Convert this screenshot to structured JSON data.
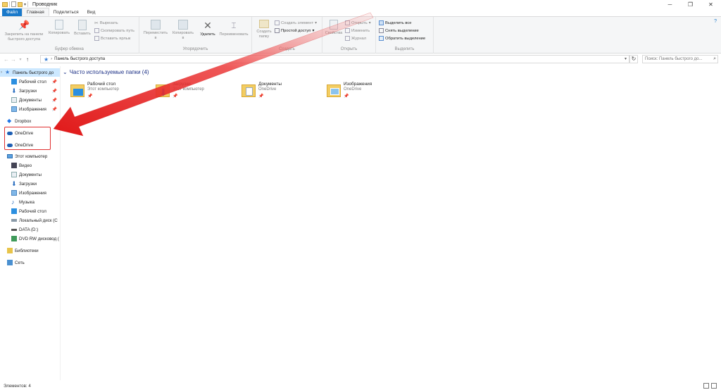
{
  "window": {
    "title": "Проводник",
    "controls": [
      "minimize",
      "maximize",
      "close"
    ]
  },
  "tabs": [
    {
      "label": "Файл",
      "kind": "file"
    },
    {
      "label": "Главная",
      "active": true
    },
    {
      "label": "Поделиться"
    },
    {
      "label": "Вид"
    }
  ],
  "ribbon": {
    "clipboard": {
      "pin_label": "Закрепить на панели\nбыстрого доступа",
      "copy_label": "Копировать",
      "paste_label": "Вставить",
      "cut_label": "Вырезать",
      "copy_path_label": "Скопировать путь",
      "paste_shortcut_label": "Вставить ярлык",
      "group_label": "Буфер обмена"
    },
    "organize": {
      "move_label": "Переместить\nв",
      "copy_to_label": "Копировать\nв",
      "delete_label": "Удалить",
      "rename_label": "Переименовать",
      "group_label": "Упорядочить"
    },
    "new": {
      "new_folder_label": "Создать\nпапку",
      "new_item_label": "Создать элемент",
      "easy_access_label": "Простой доступ",
      "group_label": "Создать"
    },
    "open": {
      "properties_label": "Свойства",
      "open_label": "Открыть",
      "edit_label": "Изменить",
      "history_label": "Журнал",
      "group_label": "Открыть"
    },
    "select": {
      "select_all_label": "Выделить все",
      "select_none_label": "Снять выделение",
      "invert_label": "Обратить выделение",
      "group_label": "Выделить"
    }
  },
  "address": {
    "path": "Панель быстрого доступа",
    "search_placeholder": "Поиск: Панель быстрого до..."
  },
  "nav": {
    "quick_access": "Панель быстрого до",
    "pinned": [
      "Рабочий стол",
      "Загрузки",
      "Документы",
      "Изображения"
    ],
    "dropbox": "Dropbox",
    "onedrive": [
      "OneDrive",
      "OneDrive"
    ],
    "this_pc": "Этот компьютер",
    "pc_items": [
      "Видео",
      "Документы",
      "Загрузки",
      "Изображения",
      "Музыка",
      "Рабочий стол",
      "Локальный диск (C",
      "DATA (D:)",
      "DVD RW дисковод ("
    ],
    "libraries": "Библиотеки",
    "network": "Сеть"
  },
  "content": {
    "group_header": "Часто используемые папки (4)",
    "tiles": [
      {
        "name": "Рабочий стол",
        "location": "Этот компьютер",
        "icon": "desktop-folder-icon"
      },
      {
        "name": "Загрузки",
        "location": "Этот компьютер",
        "icon": "downloads-folder-icon"
      },
      {
        "name": "Документы",
        "location": "OneDrive",
        "icon": "documents-folder-icon"
      },
      {
        "name": "Изображения",
        "location": "OneDrive",
        "icon": "pictures-folder-icon"
      }
    ]
  },
  "status": {
    "items_count": "Элементов: 4"
  },
  "colors": {
    "accent": "#1979ca",
    "annotation": "#e03030",
    "folder": "#f3cd62"
  }
}
